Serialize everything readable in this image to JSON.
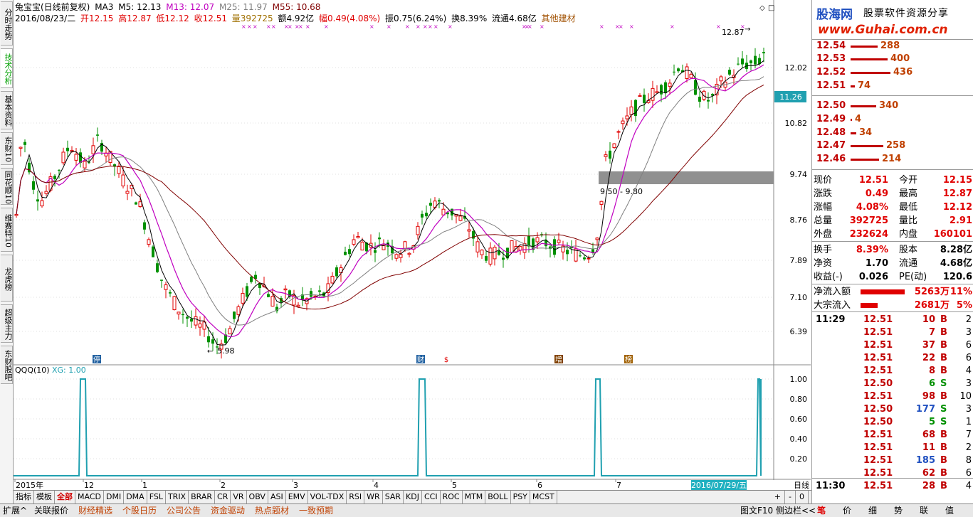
{
  "left_tabs": [
    "分时走势",
    "技术分析",
    "基本资料",
    "东财10",
    "同花顺10",
    "维赛特10",
    "龙虎榜",
    "超级主力",
    "东财股吧"
  ],
  "info": {
    "name": "兔宝宝(日线前复权)",
    "ma": "MA3",
    "m5": "M5: 12.13",
    "m13": "M13: 12.07",
    "m25": "M25: 11.97",
    "m55": "M55: 10.68",
    "date": "2016/08/23/二",
    "open": "开12.15",
    "high": "高12.87",
    "low": "低12.12",
    "close": "收12.51",
    "vol": "量392725",
    "amount": "额4.92亿",
    "amp": "幅0.49(4.08%)",
    "swing": "振0.75(6.24%)",
    "turn": "换8.39%",
    "float": "流通4.68亿",
    "sector": "其他建材"
  },
  "price_axis": [
    "12.02",
    "10.82",
    "9.74",
    "8.76",
    "7.89",
    "7.10",
    "6.39"
  ],
  "current_price_label": "11.26",
  "annotations": {
    "high": "12.87",
    "low": "5.98",
    "gap": "9.50 - 9.80"
  },
  "event_markers": [
    "停",
    "财",
    "$",
    "增",
    "榜"
  ],
  "indicator": {
    "title": "QQQ(10)",
    "xg": "XG: 1.00",
    "axis": [
      "1.00",
      "0.80",
      "0.60",
      "0.40",
      "0.20"
    ]
  },
  "time_axis": {
    "labels": [
      "2015年",
      "12",
      "1",
      "2",
      "3",
      "4",
      "5",
      "6",
      "7"
    ],
    "highlight": "2016/07/29/五",
    "period": "日线"
  },
  "tabs": [
    "指标",
    "模板",
    "全部",
    "MACD",
    "DMI",
    "DMA",
    "FSL",
    "TRIX",
    "BRAR",
    "CR",
    "VR",
    "OBV",
    "ASI",
    "EMV",
    "VOL-TDX",
    "RSI",
    "WR",
    "SAR",
    "KDJ",
    "CCI",
    "ROC",
    "MTM",
    "BOLL",
    "PSY",
    "MCST"
  ],
  "zoom_buttons": [
    "+",
    "-",
    "0"
  ],
  "bottom_links": [
    "扩展^",
    "关联报价",
    "财经精选",
    "个股日历",
    "公司公告",
    "资金驱动",
    "热点题材",
    "一致预期"
  ],
  "bottom_right": [
    "图文F10",
    "侧边栏<<"
  ],
  "bottom_right_tabs": [
    "笔",
    "价",
    "细",
    "势",
    "联",
    "值"
  ],
  "brand": {
    "logo": "股海网",
    "slogan": "股票软件资源分享",
    "url": "www.Guhai.com.cn"
  },
  "orderbook_sell": [
    {
      "price": "12.54",
      "qty": "288"
    },
    {
      "price": "12.53",
      "qty": "400"
    },
    {
      "price": "12.52",
      "qty": "436"
    },
    {
      "price": "12.51",
      "qty": "74"
    }
  ],
  "orderbook_buy": [
    {
      "price": "12.50",
      "qty": "340"
    },
    {
      "price": "12.49",
      "qty": "4"
    },
    {
      "price": "12.48",
      "qty": "34"
    },
    {
      "price": "12.47",
      "qty": "258"
    },
    {
      "price": "12.46",
      "qty": "214"
    }
  ],
  "quote": [
    {
      "l1": "现价",
      "v1": "12.51",
      "l2": "今开",
      "v2": "12.15"
    },
    {
      "l1": "涨跌",
      "v1": "0.49",
      "l2": "最高",
      "v2": "12.87"
    },
    {
      "l1": "涨幅",
      "v1": "4.08%",
      "l2": "最低",
      "v2": "12.12"
    },
    {
      "l1": "总量",
      "v1": "392725",
      "l2": "量比",
      "v2": "2.91"
    },
    {
      "l1": "外盘",
      "v1": "232624",
      "l2": "内盘",
      "v2": "160101"
    },
    {
      "l1": "换手",
      "v1": "8.39%",
      "l2": "股本",
      "v2": "8.28亿"
    },
    {
      "l1": "净资",
      "v1": "1.70",
      "l2": "流通",
      "v2": "4.68亿"
    },
    {
      "l1": "收益(-)",
      "v1": "0.026",
      "l2": "PE(动)",
      "v2": "120.6"
    }
  ],
  "flows": [
    {
      "label": "净流入额",
      "amount": "5263万",
      "pct": "11%"
    },
    {
      "label": "大宗流入",
      "amount": "2681万",
      "pct": "5%"
    }
  ],
  "ticks": [
    {
      "t": "11:29",
      "p": "12.51",
      "q": "10",
      "s": "B",
      "n": "2"
    },
    {
      "t": "",
      "p": "12.51",
      "q": "7",
      "s": "B",
      "n": "3"
    },
    {
      "t": "",
      "p": "12.51",
      "q": "37",
      "s": "B",
      "n": "6"
    },
    {
      "t": "",
      "p": "12.51",
      "q": "22",
      "s": "B",
      "n": "6"
    },
    {
      "t": "",
      "p": "12.51",
      "q": "8",
      "s": "B",
      "n": "4"
    },
    {
      "t": "",
      "p": "12.50",
      "q": "6",
      "s": "S",
      "n": "3"
    },
    {
      "t": "",
      "p": "12.51",
      "q": "98",
      "s": "B",
      "n": "10"
    },
    {
      "t": "",
      "p": "12.50",
      "q": "177",
      "s": "S",
      "n": "3"
    },
    {
      "t": "",
      "p": "12.50",
      "q": "5",
      "s": "S",
      "n": "1"
    },
    {
      "t": "",
      "p": "12.51",
      "q": "68",
      "s": "B",
      "n": "7"
    },
    {
      "t": "",
      "p": "12.51",
      "q": "11",
      "s": "B",
      "n": "2"
    },
    {
      "t": "",
      "p": "12.51",
      "q": "185",
      "s": "B",
      "n": "8"
    },
    {
      "t": "",
      "p": "12.51",
      "q": "62",
      "s": "B",
      "n": "6"
    },
    {
      "t": "11:30",
      "p": "12.51",
      "q": "28",
      "s": "B",
      "n": "4"
    }
  ],
  "colors": {
    "up": "#e00000",
    "down": "#009000",
    "ma5": "#000000",
    "ma13": "#c000c0",
    "ma25": "#808080",
    "ma55": "#800000",
    "indicator": "#20a0b0"
  }
}
